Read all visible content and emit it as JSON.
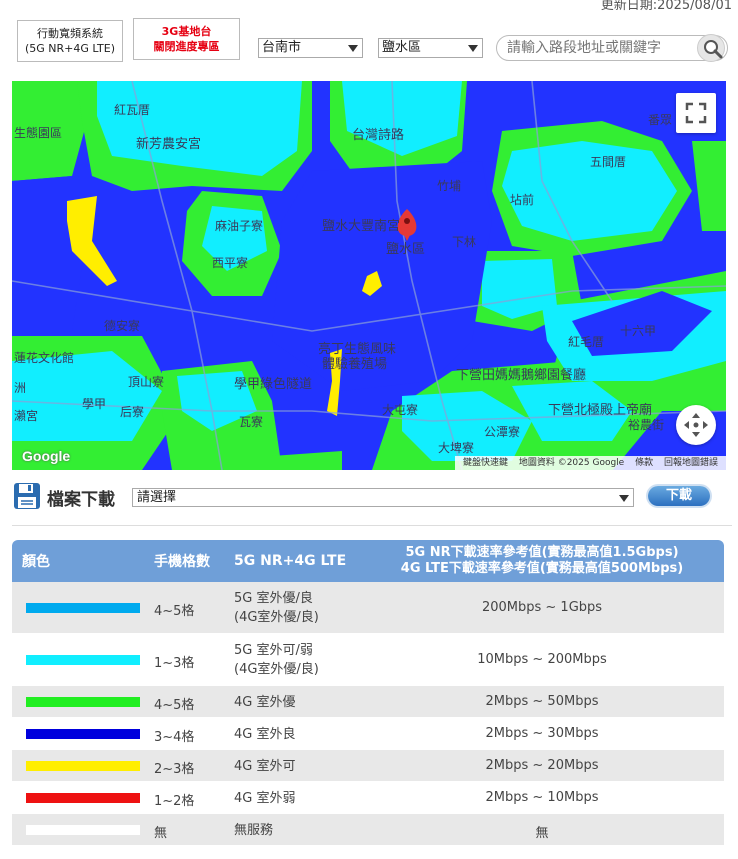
{
  "header": {
    "update_date": "更新日期:2025/08/01",
    "tab_broadband_line1": "行動寬頻系統",
    "tab_broadband_line2": "(5G NR+4G LTE)",
    "tab_3g_line1": "3G基地台",
    "tab_3g_line2": "關閉進度專區",
    "city_select": "台南市",
    "district_select": "鹽水區",
    "search_placeholder": "請輸入路段地址或關鍵字"
  },
  "map": {
    "labels": {
      "l1": "紅瓦厝",
      "l2": "新芳農安宮",
      "l3": "台灣詩路",
      "l4": "鹽水大豐南宮",
      "l5": "鹽水區",
      "l6": "麻油子寮",
      "l7": "西平寮",
      "l8": "下林",
      "l9": "竹埔",
      "l10": "坫前",
      "l11": "五間厝",
      "l12": "番眾",
      "l13": "德安寮",
      "l14": "亮丁生態風味",
      "l15": "體驗養殖場",
      "l16": "學甲綠色隧道",
      "l17": "紅毛厝",
      "l18": "十六甲",
      "l19": "下營田媽媽鵝鄉園餐廳",
      "l20": "下營北極殿上帝廟",
      "l21": "大屯寮",
      "l22": "大埤寮",
      "l23": "公潭寮",
      "l24": "裕農街",
      "l25": "瓦寮",
      "l26": "學甲",
      "l27": "頂山寮",
      "l28": "生態園區",
      "l29": "蓮花文化館",
      "l30": "瀨宮",
      "l31": "洲",
      "l32": "后寮"
    },
    "google_logo": "Google",
    "attribution": [
      "鍵盤快速鍵",
      "地圖資料 ©2025 Google",
      "條款",
      "回報地圖錯誤"
    ]
  },
  "download": {
    "title": "檔案下載",
    "select_value": "請選擇",
    "button": "下載"
  },
  "legend": {
    "headers": {
      "color": "顏色",
      "bars": "手機格數",
      "type": "5G NR+4G LTE",
      "speed_line1": "5G NR下載速率參考值(實務最高值1.5Gbps)",
      "speed_line2": "4G LTE下載速率參考值(實務最高值500Mbps)"
    },
    "rows": [
      {
        "color": "#00aaee",
        "bars": "4~5格",
        "type1": "5G 室外優/良",
        "type2": "(4G室外優/良)",
        "speed": "200Mbps ~ 1Gbps"
      },
      {
        "color": "#11eeff",
        "bars": "1~3格",
        "type1": "5G 室外可/弱",
        "type2": "(4G室外優/良)",
        "speed": "10Mbps ~ 200Mbps"
      },
      {
        "color": "#22ee22",
        "bars": "4~5格",
        "type1": "4G 室外優",
        "type2": "",
        "speed": "2Mbps ~ 50Mbps"
      },
      {
        "color": "#0000dd",
        "bars": "3~4格",
        "type1": "4G 室外良",
        "type2": "",
        "speed": "2Mbps ~ 30Mbps"
      },
      {
        "color": "#ffee00",
        "bars": "2~3格",
        "type1": "4G 室外可",
        "type2": "",
        "speed": "2Mbps ~ 20Mbps"
      },
      {
        "color": "#ee1111",
        "bars": "1~2格",
        "type1": "4G 室外弱",
        "type2": "",
        "speed": "2Mbps ~ 10Mbps"
      },
      {
        "color": "#ffffff",
        "bars": "無",
        "type1": "無服務",
        "type2": "",
        "speed": "無"
      }
    ]
  }
}
